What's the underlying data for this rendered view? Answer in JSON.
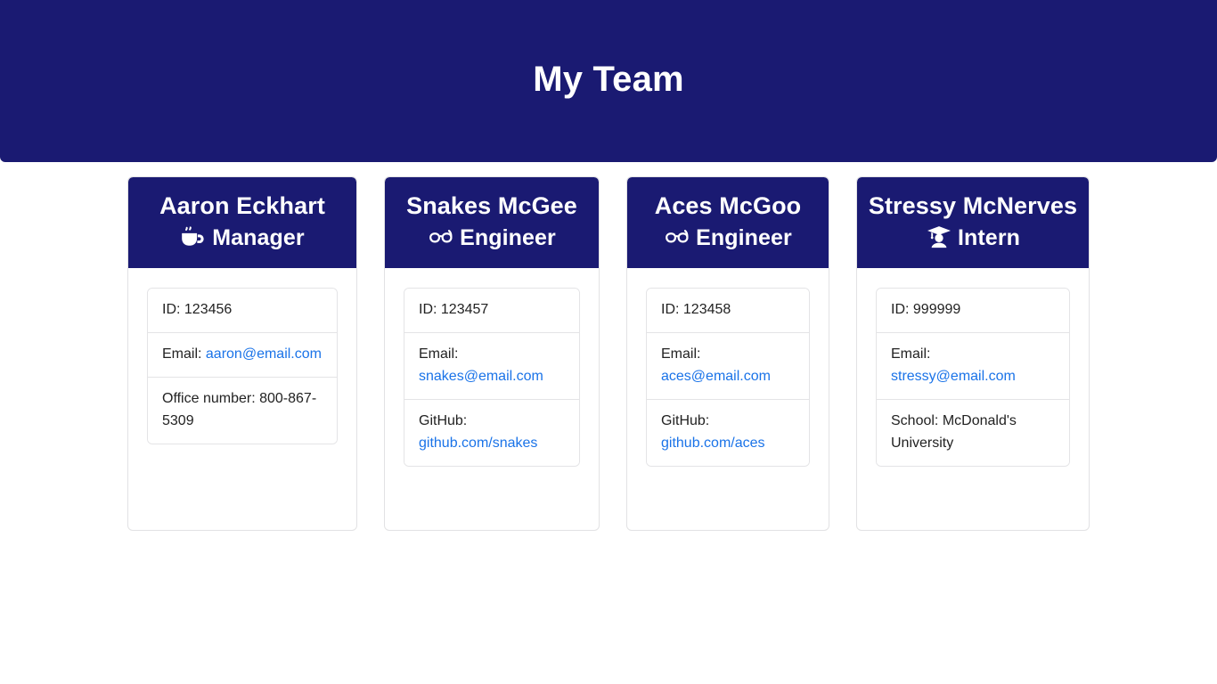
{
  "header": {
    "title": "My Team"
  },
  "colors": {
    "brand_navy": "#1a1a72",
    "link_blue": "#1a73e8",
    "page_background": "#ffffff",
    "card_border": "#e2e2e4"
  },
  "cards": [
    {
      "name": "Aaron Eckhart",
      "role": "Manager",
      "role_icon": "coffee-mug-icon",
      "items": [
        {
          "label": "ID: ",
          "value": "123456",
          "link": false
        },
        {
          "label": "Email: ",
          "value": "aaron@email.com",
          "link": true
        },
        {
          "label": "Office number: ",
          "value": "800-867-5309",
          "link": false
        }
      ]
    },
    {
      "name": "Snakes McGee",
      "role": "Engineer",
      "role_icon": "glasses-icon",
      "items": [
        {
          "label": "ID: ",
          "value": "123457",
          "link": false
        },
        {
          "label": "Email: ",
          "value": "snakes@email.com",
          "link": true
        },
        {
          "label": "GitHub: ",
          "value": "github.com/snakes",
          "link": true
        }
      ]
    },
    {
      "name": "Aces McGoo",
      "role": "Engineer",
      "role_icon": "glasses-icon",
      "items": [
        {
          "label": "ID: ",
          "value": "123458",
          "link": false
        },
        {
          "label": "Email: ",
          "value": "aces@email.com",
          "link": true
        },
        {
          "label": "GitHub: ",
          "value": "github.com/aces",
          "link": true
        }
      ]
    },
    {
      "name": "Stressy McNerves",
      "role": "Intern",
      "role_icon": "graduate-student-icon",
      "items": [
        {
          "label": "ID: ",
          "value": "999999",
          "link": false
        },
        {
          "label": "Email: ",
          "value": "stressy@email.com",
          "link": true
        },
        {
          "label": "School: ",
          "value": "McDonald's University",
          "link": false
        }
      ]
    }
  ]
}
